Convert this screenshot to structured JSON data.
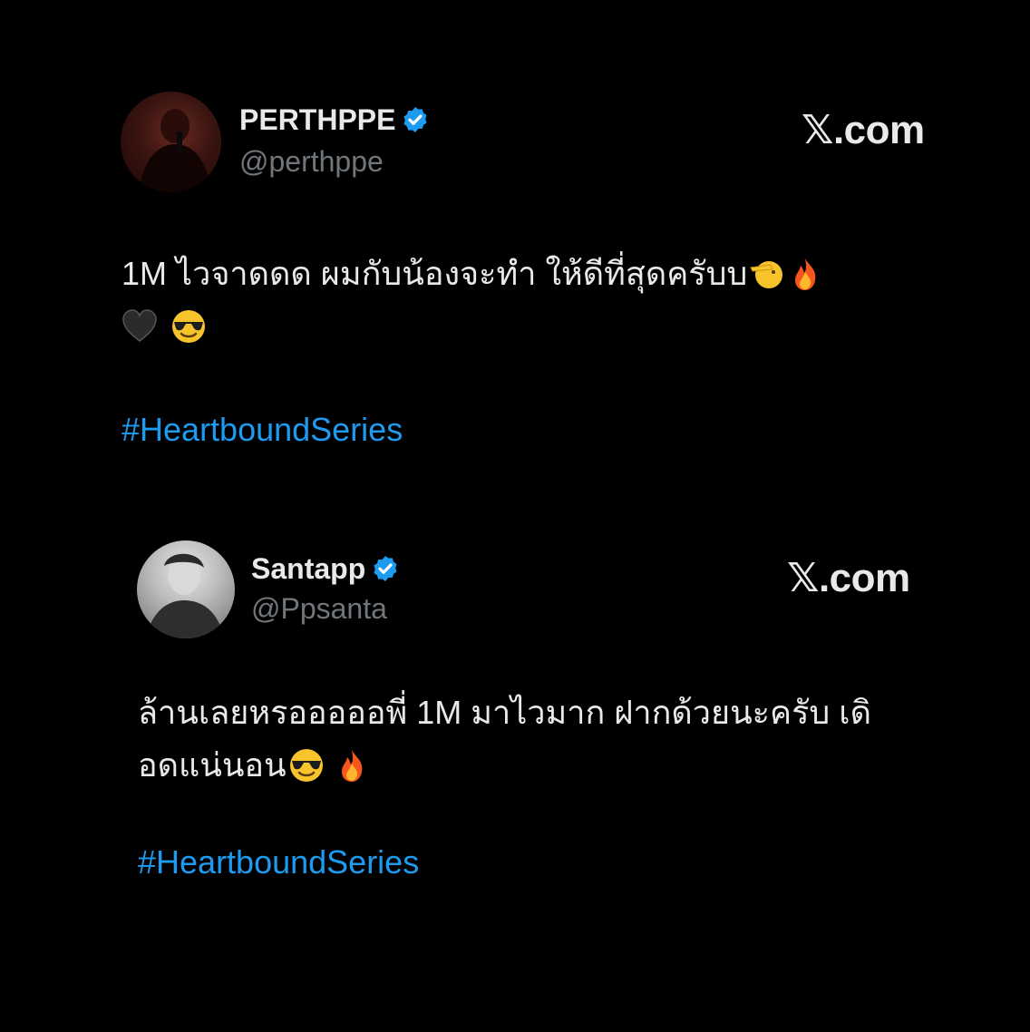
{
  "posts": [
    {
      "display_name": "PERTHPPE",
      "handle": "@perthppe",
      "site": ".com",
      "site_mark": "𝕏",
      "text_lines": [
        "1M ไวจาดดด ผมกับน้องจะทำ ให้ดีที่สุดครับบ",
        ""
      ],
      "hashtag": "#HeartboundSeries",
      "emoji_line1": [
        "saluting-face-emoji",
        "fire-emoji"
      ],
      "emoji_line2": [
        "black-heart-emoji",
        "smiling-face-with-sunglasses-emoji"
      ]
    },
    {
      "display_name": "Santapp",
      "handle": "@Ppsanta",
      "site": ".com",
      "site_mark": "𝕏",
      "text_lines": [
        "ล้านเลยหรอออออพี่  1M มาไวมาก ฝากด้วยนะครับ เดิ",
        "อดแน่นอน"
      ],
      "hashtag": "#HeartboundSeries",
      "emoji_line2": [
        "smiling-face-with-sunglasses-emoji",
        "fire-emoji"
      ]
    }
  ],
  "colors": {
    "background": "#000000",
    "verified": "#1d9bf0",
    "hashtag": "#1d9bf0",
    "handle": "#71767b",
    "text": "#e7e9ea"
  }
}
